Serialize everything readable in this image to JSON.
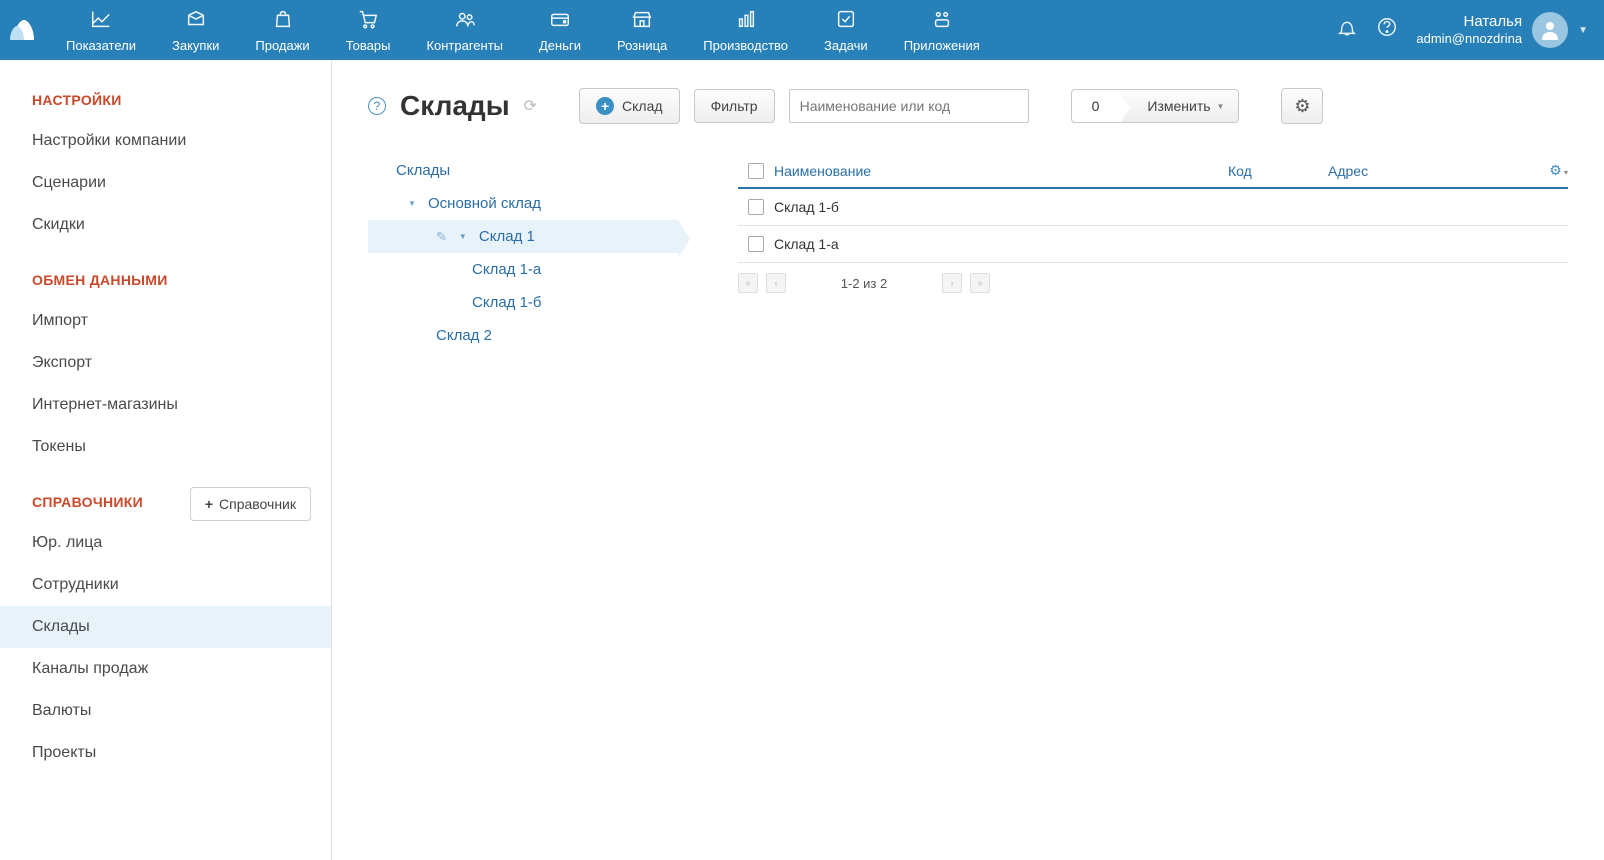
{
  "topnav": {
    "items": [
      {
        "label": "Показатели"
      },
      {
        "label": "Закупки"
      },
      {
        "label": "Продажи"
      },
      {
        "label": "Товары"
      },
      {
        "label": "Контрагенты"
      },
      {
        "label": "Деньги"
      },
      {
        "label": "Розница"
      },
      {
        "label": "Производство"
      },
      {
        "label": "Задачи"
      },
      {
        "label": "Приложения"
      }
    ],
    "user": {
      "name": "Наталья",
      "email": "admin@nnozdrina"
    }
  },
  "sidebar": {
    "sections": {
      "settings": {
        "title": "НАСТРОЙКИ",
        "items": [
          "Настройки компании",
          "Сценарии",
          "Скидки"
        ]
      },
      "exchange": {
        "title": "ОБМЕН ДАННЫМИ",
        "items": [
          "Импорт",
          "Экспорт",
          "Интернет-магазины",
          "Токены"
        ]
      },
      "refs": {
        "title": "СПРАВОЧНИКИ",
        "add_btn": "Справочник",
        "items": [
          "Юр. лица",
          "Сотрудники",
          "Склады",
          "Каналы продаж",
          "Валюты",
          "Проекты"
        ]
      }
    },
    "active_item": "Склады"
  },
  "page": {
    "title": "Склады",
    "add_btn": "Склад",
    "filter_btn": "Фильтр",
    "search_placeholder": "Наименование или код",
    "counter": "0",
    "change_btn": "Изменить"
  },
  "tree": {
    "root": "Склады",
    "items": [
      {
        "label": "Основной склад",
        "level": 1,
        "expandable": true
      },
      {
        "label": "Склад 1",
        "level": 2,
        "expandable": true,
        "selected": true
      },
      {
        "label": "Склад 1-а",
        "level": 3
      },
      {
        "label": "Склад 1-б",
        "level": 3
      },
      {
        "label": "Склад 2",
        "level": 2
      }
    ]
  },
  "table": {
    "columns": {
      "name": "Наименование",
      "code": "Код",
      "address": "Адрес"
    },
    "rows": [
      {
        "name": "Склад 1-б",
        "code": "",
        "address": ""
      },
      {
        "name": "Склад 1-а",
        "code": "",
        "address": ""
      }
    ],
    "pager_info": "1-2 из 2"
  }
}
